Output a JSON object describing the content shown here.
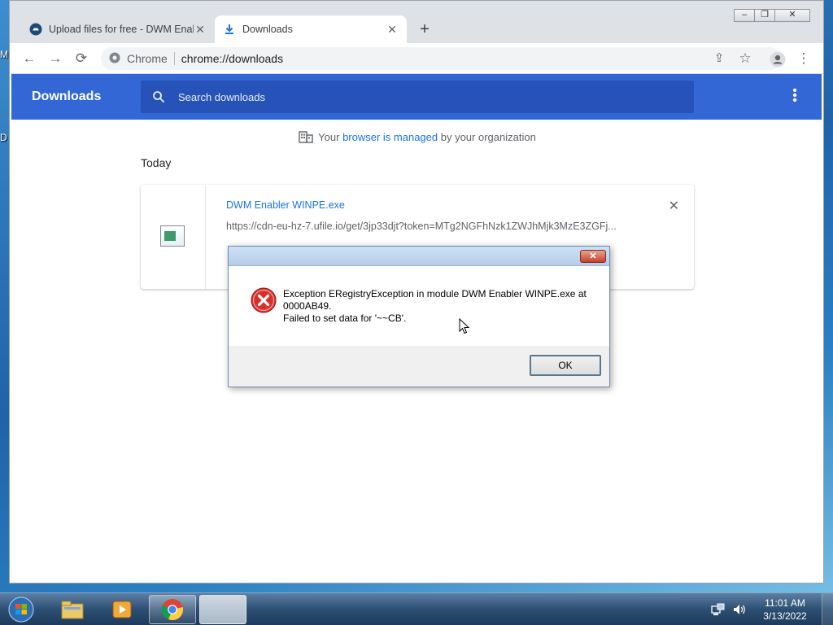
{
  "desktop": {
    "fragments": [
      "M",
      "D"
    ]
  },
  "browser": {
    "tabs": [
      {
        "title": "Upload files for free - DWM Enabler",
        "active": false
      },
      {
        "title": "Downloads",
        "active": true
      }
    ],
    "omnibox": {
      "scheme_label": "Chrome",
      "url": "chrome://downloads"
    },
    "window_controls": [
      "minimize",
      "restore",
      "close"
    ]
  },
  "downloads": {
    "header_title": "Downloads",
    "search_placeholder": "Search downloads",
    "managed_notice": {
      "prefix": "Your ",
      "link": "browser is managed",
      "suffix": " by your organization"
    },
    "section_date": "Today",
    "items": [
      {
        "filename": "DWM Enabler WINPE.exe",
        "url": "https://cdn-eu-hz-7.ufile.io/get/3jp33djt?token=MTg2NGFhNzk1ZWJhMjk3MzE3ZGFj..."
      }
    ]
  },
  "dialog": {
    "message_line1": "Exception ERegistryException in module DWM Enabler WINPE.exe at 0000AB49.",
    "message_line2": "Failed to set data for '~~CB'.",
    "ok_label": "OK",
    "close_label": "✕"
  },
  "taskbar": {
    "items": [
      "start-orb-icon",
      "explorer-icon",
      "media-player-icon",
      "chrome-icon",
      "blank-window"
    ],
    "clock": {
      "time": "11:01 AM",
      "date": "3/13/2022"
    }
  },
  "colors": {
    "accent": "#3367d6",
    "link": "#1a73e8",
    "error_red": "#d9302c"
  }
}
